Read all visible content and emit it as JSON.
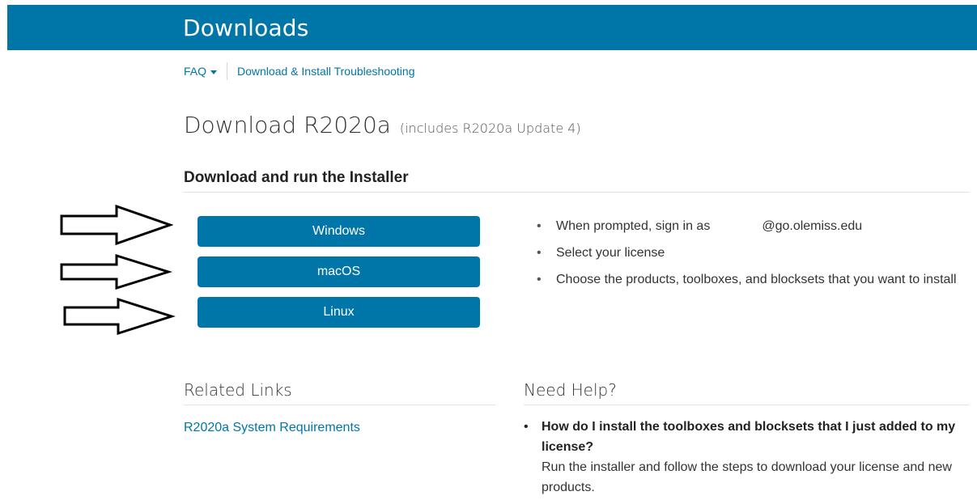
{
  "header": {
    "title": "Downloads"
  },
  "subnav": {
    "faq_label": "FAQ",
    "troubleshooting_label": "Download & Install Troubleshooting"
  },
  "page": {
    "title": "Download R2020a",
    "subtitle": "(includes R2020a Update 4)"
  },
  "installer": {
    "heading": "Download and run the Installer",
    "buttons": [
      "Windows",
      "macOS",
      "Linux"
    ],
    "steps": [
      {
        "before": "When prompted, sign in as",
        "after": "@go.olemiss.edu"
      },
      {
        "text": "Select your license"
      },
      {
        "text": "Choose the products, toolboxes, and blocksets that you want to install"
      }
    ]
  },
  "related": {
    "heading": "Related Links",
    "links": [
      "R2020a System Requirements"
    ]
  },
  "help": {
    "heading": "Need Help?",
    "question": "How do I install the toolboxes and blocksets that I just added to my license?",
    "answer": "Run the installer and follow the steps to download your license and new products."
  },
  "colors": {
    "brand": "#0076a8"
  },
  "annotations": {
    "arrows": [
      "right-arrow",
      "right-arrow",
      "right-arrow"
    ]
  }
}
